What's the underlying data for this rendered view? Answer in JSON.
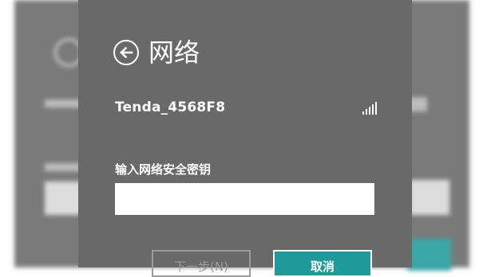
{
  "header": {
    "title": "网络",
    "back_icon": "arrow-left-circle-icon"
  },
  "network": {
    "ssid": "Tenda_4568F8",
    "signal_icon": "wifi-signal-icon"
  },
  "security_key": {
    "label": "输入网络安全密钥",
    "value": ""
  },
  "buttons": {
    "next_label": "下一步(N)",
    "cancel_label": "取消"
  },
  "colors": {
    "panel": "#696969",
    "accent": "#1f9a9a",
    "text": "#ffffff"
  }
}
